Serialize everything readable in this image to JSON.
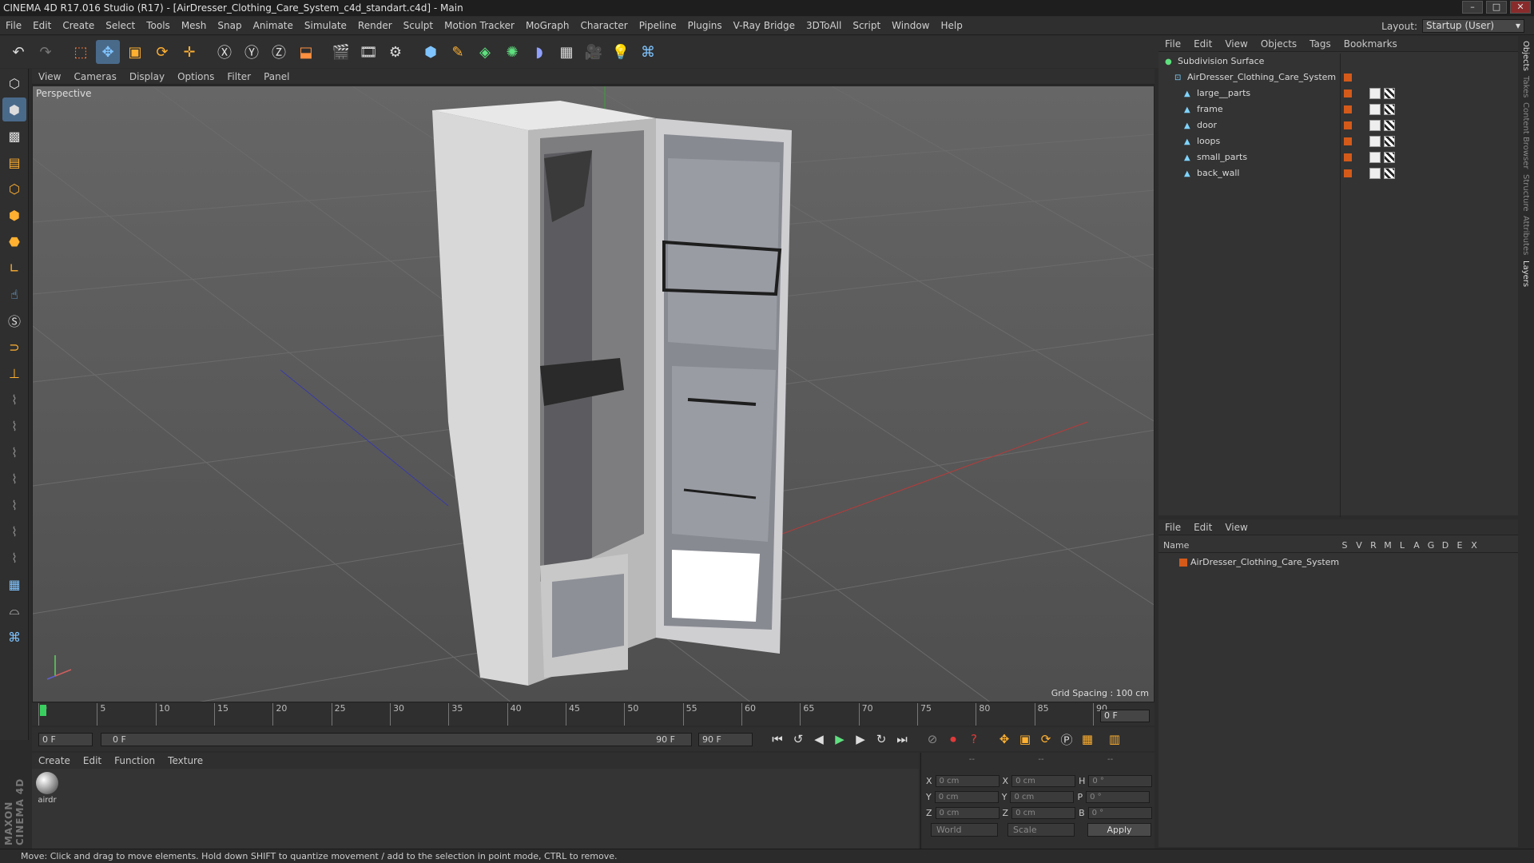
{
  "window": {
    "title": "CINEMA 4D R17.016 Studio (R17) - [AirDresser_Clothing_Care_System_c4d_standart.c4d] - Main"
  },
  "menu": [
    "File",
    "Edit",
    "Create",
    "Select",
    "Tools",
    "Mesh",
    "Snap",
    "Animate",
    "Simulate",
    "Render",
    "Sculpt",
    "Motion Tracker",
    "MoGraph",
    "Character",
    "Pipeline",
    "Plugins",
    "V-Ray Bridge",
    "3DToAll",
    "Script",
    "Window",
    "Help"
  ],
  "layout": {
    "label": "Layout:",
    "value": "Startup (User)"
  },
  "viewport": {
    "menu": [
      "View",
      "Cameras",
      "Display",
      "Options",
      "Filter",
      "Panel"
    ],
    "label": "Perspective",
    "grid_spacing": "Grid Spacing : 100 cm"
  },
  "timeline": {
    "ticks": [
      "0",
      "5",
      "10",
      "15",
      "20",
      "25",
      "30",
      "35",
      "40",
      "45",
      "50",
      "55",
      "60",
      "65",
      "70",
      "75",
      "80",
      "85",
      "90"
    ],
    "current_frame": "0 F",
    "start_field": "0 F",
    "range_start": "0 F",
    "range_end": "90 F",
    "end_field": "90 F"
  },
  "material_manager": {
    "menu": [
      "Create",
      "Edit",
      "Function",
      "Texture"
    ],
    "materials": [
      {
        "name": "airdr"
      }
    ]
  },
  "coords": {
    "headers": [
      "--",
      "--",
      "--"
    ],
    "rows": [
      {
        "a": "X",
        "av": "0 cm",
        "b": "X",
        "bv": "0 cm",
        "c": "H",
        "cv": "0 °"
      },
      {
        "a": "Y",
        "av": "0 cm",
        "b": "Y",
        "bv": "0 cm",
        "c": "P",
        "cv": "0 °"
      },
      {
        "a": "Z",
        "av": "0 cm",
        "b": "Z",
        "bv": "0 cm",
        "c": "B",
        "cv": "0 °"
      }
    ],
    "mode1": "World",
    "mode2": "Scale",
    "apply": "Apply"
  },
  "brand": "MAXON CINEMA 4D",
  "object_manager": {
    "menu": [
      "File",
      "Edit",
      "View",
      "Objects",
      "Tags",
      "Bookmarks"
    ],
    "objects": [
      {
        "name": "Subdivision Surface",
        "level": 0
      },
      {
        "name": "AirDresser_Clothing_Care_System",
        "level": 1
      },
      {
        "name": "large__parts",
        "level": 2
      },
      {
        "name": "frame",
        "level": 2
      },
      {
        "name": "door",
        "level": 2
      },
      {
        "name": "loops",
        "level": 2
      },
      {
        "name": "small_parts",
        "level": 2
      },
      {
        "name": "back_wall",
        "level": 2
      }
    ]
  },
  "layer_manager": {
    "menu": [
      "File",
      "Edit",
      "View"
    ],
    "name_header": "Name",
    "col_headers": [
      "S",
      "V",
      "R",
      "M",
      "L",
      "A",
      "G",
      "D",
      "E",
      "X"
    ],
    "layers": [
      {
        "name": "AirDresser_Clothing_Care_System"
      }
    ]
  },
  "right_tabs": [
    "Objects",
    "Takes",
    "Content Browser",
    "Structure",
    "Attributes",
    "Layers"
  ],
  "status": "Move: Click and drag to move elements. Hold down SHIFT to quantize movement / add to the selection in point mode, CTRL to remove.",
  "colors": {
    "accent": "#d45a1a",
    "bg": "#2f2f2f",
    "viewport": "#5a5a5a"
  }
}
